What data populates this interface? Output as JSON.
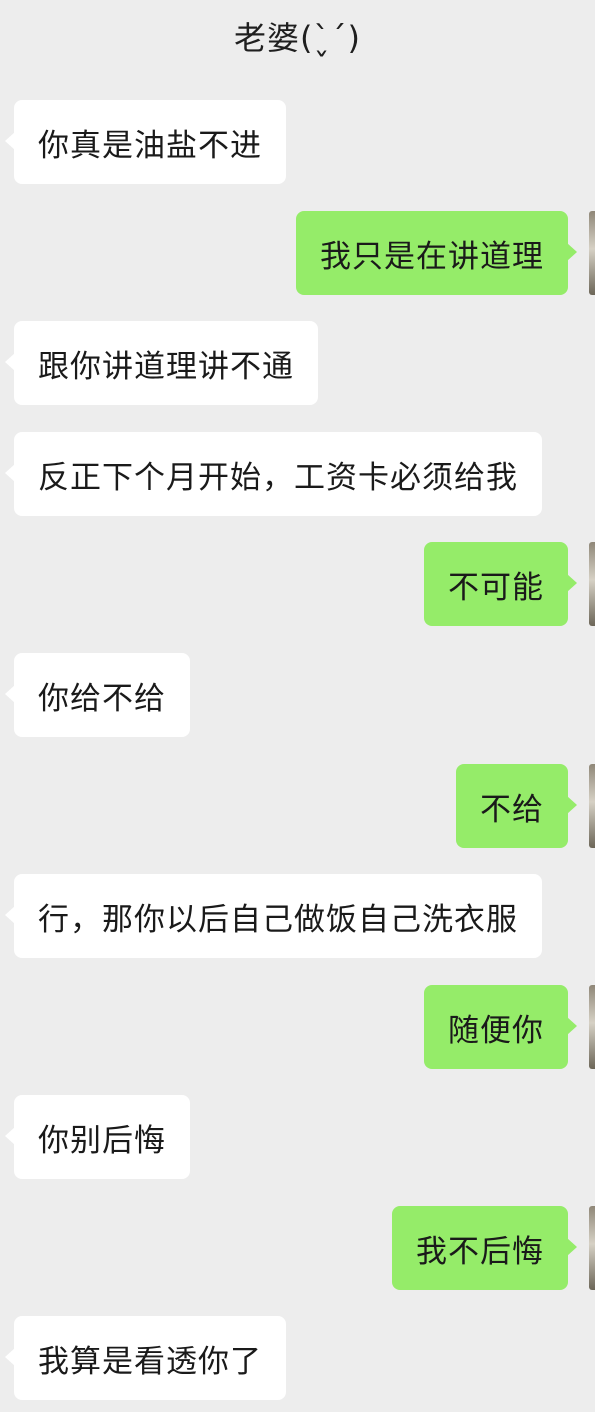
{
  "header": {
    "title": "老婆(ˋ̬ˊ)"
  },
  "messages": [
    {
      "side": "in",
      "text": "你真是油盐不进"
    },
    {
      "side": "out",
      "text": "我只是在讲道理"
    },
    {
      "side": "in",
      "text": "跟你讲道理讲不通"
    },
    {
      "side": "in",
      "text": "反正下个月开始，工资卡必须给我"
    },
    {
      "side": "out",
      "text": "不可能"
    },
    {
      "side": "in",
      "text": "你给不给"
    },
    {
      "side": "out",
      "text": "不给"
    },
    {
      "side": "in",
      "text": "行，那你以后自己做饭自己洗衣服"
    },
    {
      "side": "out",
      "text": "随便你"
    },
    {
      "side": "in",
      "text": "你别后悔"
    },
    {
      "side": "out",
      "text": "我不后悔"
    },
    {
      "side": "in",
      "text": "我算是看透你了"
    }
  ]
}
